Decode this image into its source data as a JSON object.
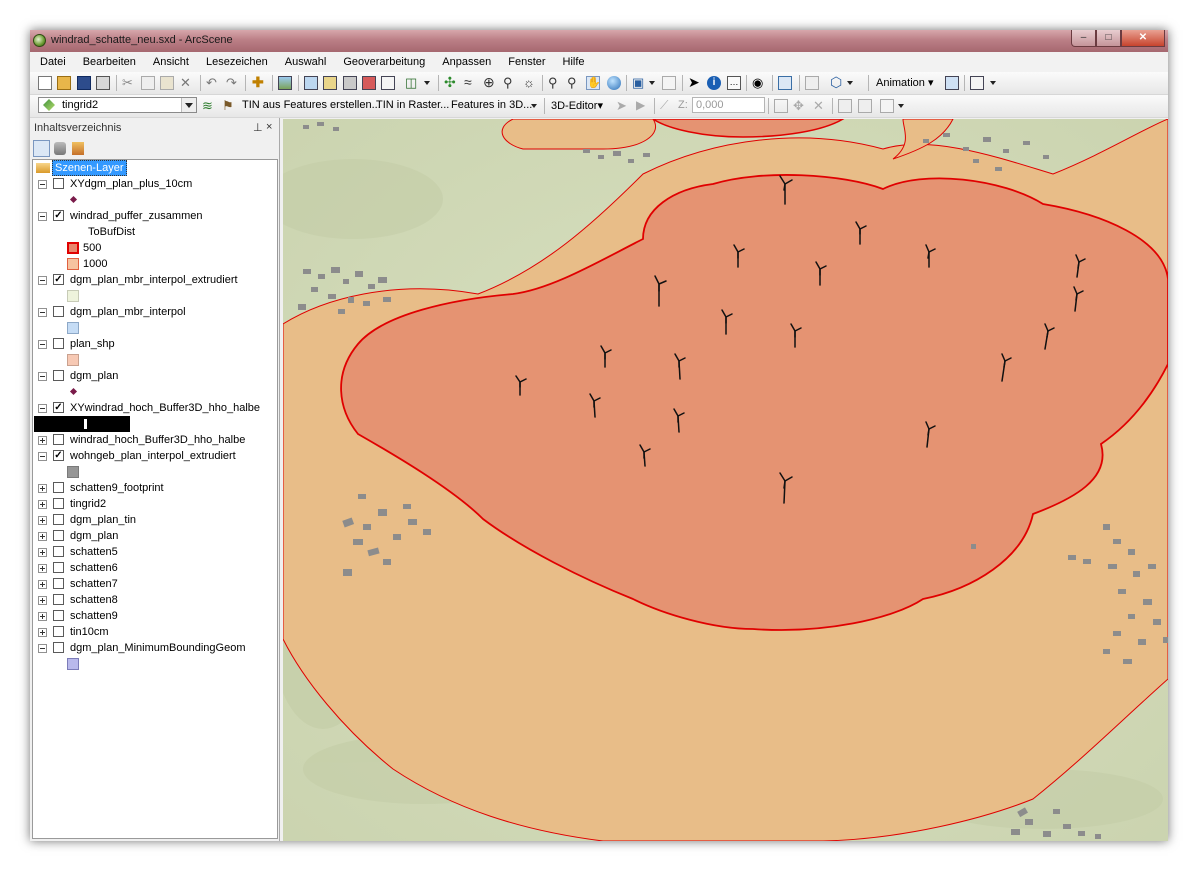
{
  "window": {
    "title": "windrad_schatte_neu.sxd - ArcScene"
  },
  "menu": [
    "Datei",
    "Bearbeiten",
    "Ansicht",
    "Lesezeichen",
    "Auswahl",
    "Geoverarbeitung",
    "Anpassen",
    "Fenster",
    "Hilfe"
  ],
  "toolbar1": {
    "animation_label": "Animation"
  },
  "toolbar2": {
    "layer_combo": "tingrid2",
    "btn_tin_from_features": "TIN aus Features erstellen...",
    "btn_tin_to_raster": "TIN in Raster...",
    "btn_features_3d": "Features in 3D...",
    "editor_label": "3D-Editor",
    "z_label": "Z:",
    "z_value": "0,000"
  },
  "toc": {
    "title": "Inhaltsverzeichnis",
    "root": "Szenen-Layer",
    "layers": [
      {
        "name": "XYdgm_plan_plus_10cm",
        "checked": false,
        "expanded": true
      },
      {
        "name": "windrad_puffer_zusammen",
        "checked": true,
        "expanded": true,
        "field": "ToBufDist",
        "classes": [
          {
            "label": "500",
            "color": "#e8866c",
            "outline": "#e00000"
          },
          {
            "label": "1000",
            "color": "#f6c3a0",
            "outline": "#e06040"
          }
        ]
      },
      {
        "name": "dgm_plan_mbr_interpol_extrudiert",
        "checked": true,
        "expanded": true,
        "color": "#eef3dc"
      },
      {
        "name": "dgm_plan_mbr_interpol",
        "checked": false,
        "expanded": true,
        "color": "#c5dcf5"
      },
      {
        "name": "plan_shp",
        "checked": false,
        "expanded": true,
        "color": "#f7c9b4"
      },
      {
        "name": "dgm_plan",
        "checked": false,
        "expanded": true
      },
      {
        "name": "XYwindrad_hoch_Buffer3D_hho_halbe",
        "checked": true,
        "expanded": true
      },
      {
        "name": "windrad_hoch_Buffer3D_hho_halbe",
        "checked": false,
        "expanded": false
      },
      {
        "name": "wohngeb_plan_interpol_extrudiert",
        "checked": true,
        "expanded": true,
        "color": "#969696"
      },
      {
        "name": "schatten9_footprint",
        "checked": false,
        "expanded": false
      },
      {
        "name": "tingrid2",
        "checked": false,
        "expanded": false
      },
      {
        "name": "dgm_plan_tin",
        "checked": false,
        "expanded": false
      },
      {
        "name": "dgm_plan",
        "checked": false,
        "expanded": false
      },
      {
        "name": "schatten5",
        "checked": false,
        "expanded": false
      },
      {
        "name": "schatten6",
        "checked": false,
        "expanded": false
      },
      {
        "name": "schatten7",
        "checked": false,
        "expanded": false
      },
      {
        "name": "schatten8",
        "checked": false,
        "expanded": false
      },
      {
        "name": "schatten9",
        "checked": false,
        "expanded": false
      },
      {
        "name": "tin10cm",
        "checked": false,
        "expanded": false
      },
      {
        "name": "dgm_plan_MinimumBoundingGeom",
        "checked": false,
        "expanded": true,
        "color": "#b9b9ec"
      }
    ]
  },
  "colors": {
    "terrain": "#d3dcba",
    "buffer_outer": "#e8bd88",
    "buffer_inner": "#e59372",
    "buffer_line": "#e00000",
    "turbine": "#111111",
    "building": "#8c8c8c"
  }
}
